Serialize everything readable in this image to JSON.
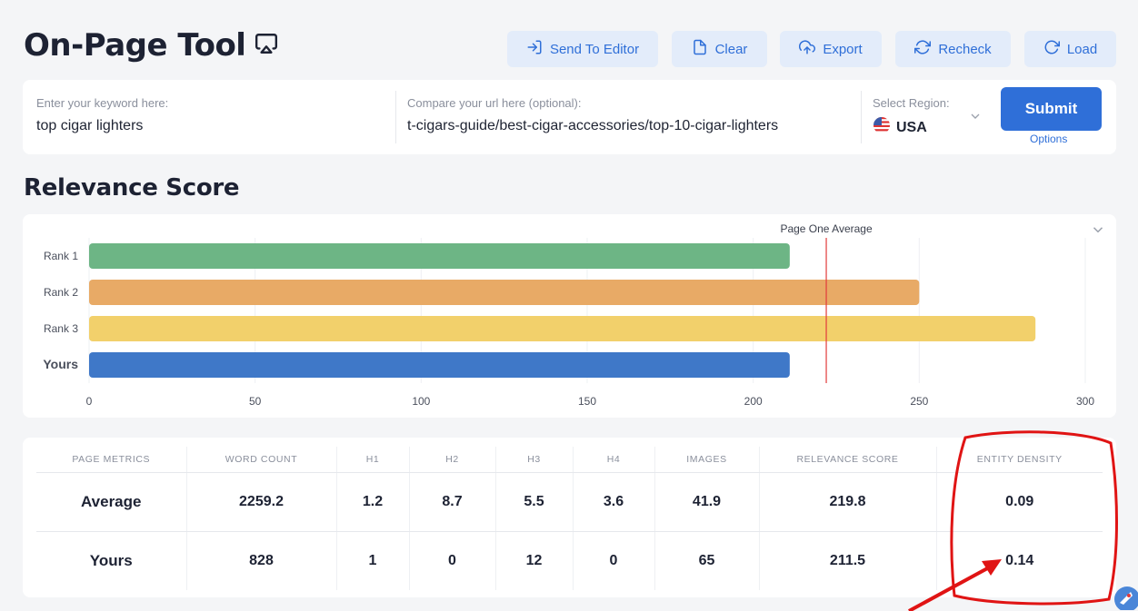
{
  "header": {
    "title": "On-Page Tool",
    "buttons": {
      "send_to_editor": "Send To Editor",
      "clear": "Clear",
      "export": "Export",
      "recheck": "Recheck",
      "load": "Load"
    }
  },
  "form": {
    "keyword_label": "Enter your keyword here:",
    "keyword_value": "top cigar lighters",
    "url_label": "Compare your url here (optional):",
    "url_value": "t-cigars-guide/best-cigar-accessories/top-10-cigar-lighters",
    "region_label": "Select Region:",
    "region_value": "USA",
    "submit_label": "Submit",
    "options_label": "Options"
  },
  "relevance": {
    "section_title": "Relevance Score"
  },
  "chart_data": {
    "type": "bar",
    "orientation": "horizontal",
    "categories": [
      "Rank 1",
      "Rank 2",
      "Rank 3",
      "Yours"
    ],
    "values": [
      211,
      250,
      285,
      211
    ],
    "colors": [
      "#6db585",
      "#e8aa66",
      "#f2d06b",
      "#3f78c8"
    ],
    "xlim": [
      0,
      300
    ],
    "xticks": [
      0,
      50,
      100,
      150,
      200,
      250,
      300
    ],
    "reference_line": {
      "label": "Page One Average",
      "value": 222,
      "color": "#e23b3b"
    },
    "grid": true
  },
  "metrics": {
    "headers": [
      "PAGE METRICS",
      "WORD COUNT",
      "H1",
      "H2",
      "H3",
      "H4",
      "IMAGES",
      "RELEVANCE SCORE",
      "ENTITY DENSITY"
    ],
    "rows": [
      [
        "Average",
        "2259.2",
        "1.2",
        "8.7",
        "5.5",
        "3.6",
        "41.9",
        "219.8",
        "0.09"
      ],
      [
        "Yours",
        "828",
        "1",
        "0",
        "12",
        "0",
        "65",
        "211.5",
        "0.14"
      ]
    ]
  },
  "colors": {
    "accent": "#2f6fd8",
    "button_bg": "#e3ecfa",
    "annotation": "#e01414"
  },
  "icons": [
    "airplay-icon",
    "send-icon",
    "file-icon",
    "cloud-upload-icon",
    "refresh-icon",
    "reload-icon",
    "us-flag-icon",
    "chevron-down-icon",
    "rocket-icon"
  ]
}
